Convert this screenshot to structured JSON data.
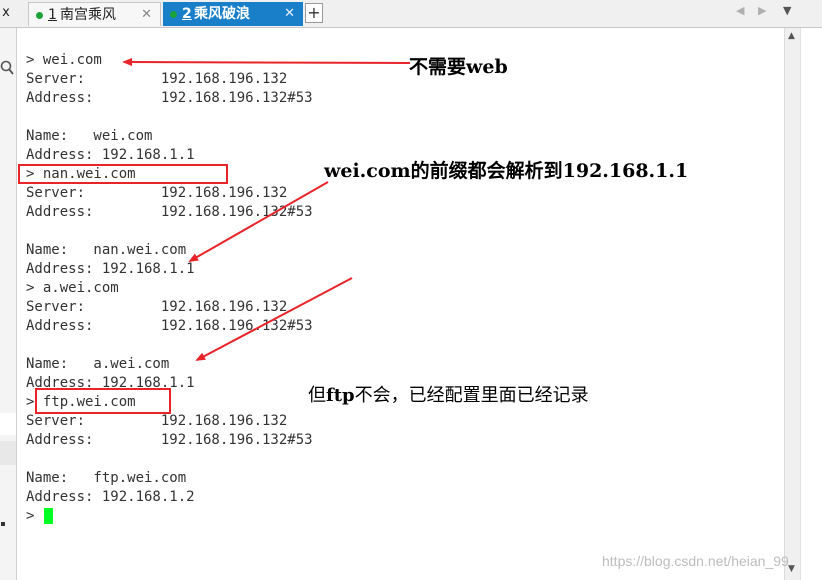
{
  "tabs": [
    {
      "number": "1",
      "name": "南宫乘风",
      "active": false
    },
    {
      "number": "2",
      "name": "乘风破浪",
      "active": true
    }
  ],
  "tabbar": {
    "close_glyph": "x",
    "tab_close": "✕",
    "add_tab": "+",
    "nav_left": "◀",
    "nav_right": "▶",
    "nav_menu": "▼"
  },
  "sidebar": {
    "search_icon": "search-icon"
  },
  "terminal": {
    "lines": [
      "> wei.com",
      "Server:         192.168.196.132",
      "Address:        192.168.196.132#53",
      "",
      "Name:   wei.com",
      "Address: 192.168.1.1",
      "> nan.wei.com",
      "Server:         192.168.196.132",
      "Address:        192.168.196.132#53",
      "",
      "Name:   nan.wei.com",
      "Address: 192.168.1.1",
      "> a.wei.com",
      "Server:         192.168.196.132",
      "Address:        192.168.196.132#53",
      "",
      "Name:   a.wei.com",
      "Address: 192.168.1.1",
      "> ftp.wei.com",
      "Server:         192.168.196.132",
      "Address:        192.168.196.132#53",
      "",
      "Name:   ftp.wei.com",
      "Address: 192.168.1.2",
      ">"
    ],
    "cursor_color": "#00ff22"
  },
  "annotations": {
    "note1": "不需要web",
    "note2": "wei.com的前缀都会解析到192.168.1.1",
    "note3_prefix": "但",
    "note3_bold": "ftp",
    "note3_suffix": "不会，已经配置里面已经记录"
  },
  "colors": {
    "annotation_red": "#e8242a",
    "tab_active_bg": "#1a7fc9",
    "status_dot": "#1aa33a"
  },
  "watermark": "https://blog.csdn.net/heian_99"
}
